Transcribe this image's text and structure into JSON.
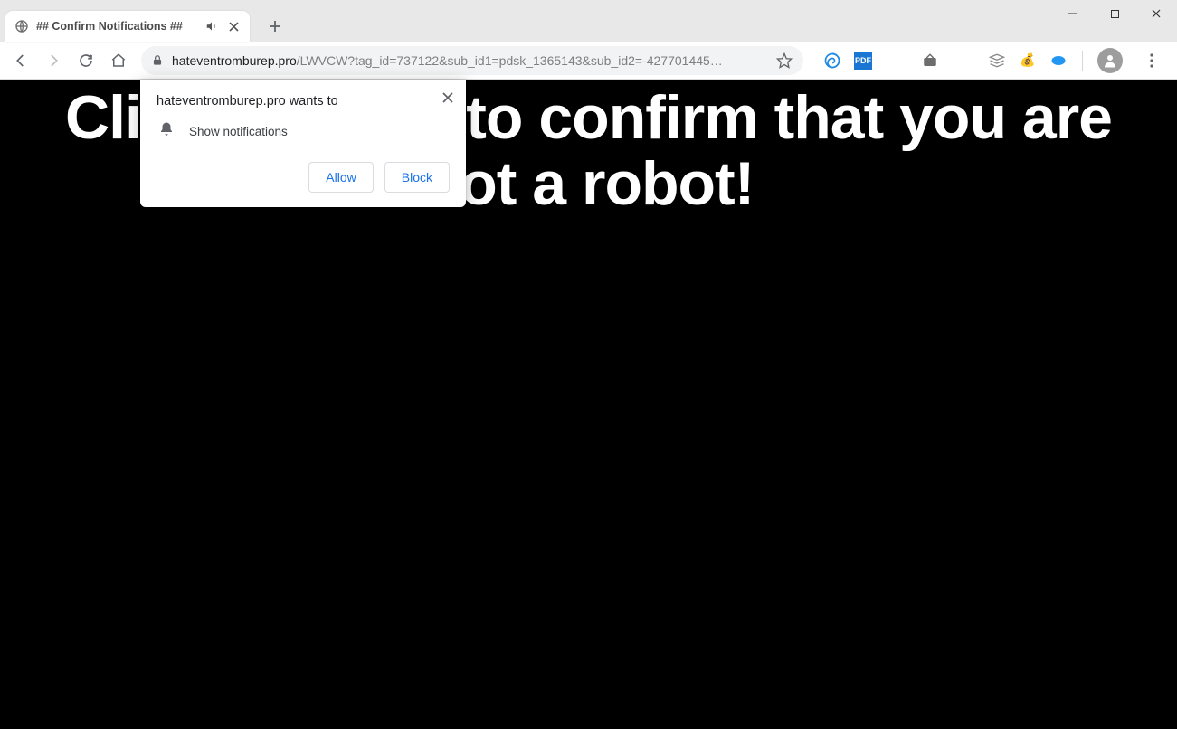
{
  "window": {
    "tab_title": "## Confirm Notifications ##"
  },
  "address": {
    "host": "hateventromburep.pro",
    "path": "/LWVCW?tag_id=737122&sub_id1=pdsk_1365143&sub_id2=-427701445…"
  },
  "page": {
    "headline": "Click «Allow» to confirm that you are not a robot!"
  },
  "permission": {
    "title": "hateventromburep.pro wants to",
    "label": "Show notifications",
    "allow": "Allow",
    "block": "Block"
  },
  "extensions": {
    "pdf_label": "PDF"
  }
}
